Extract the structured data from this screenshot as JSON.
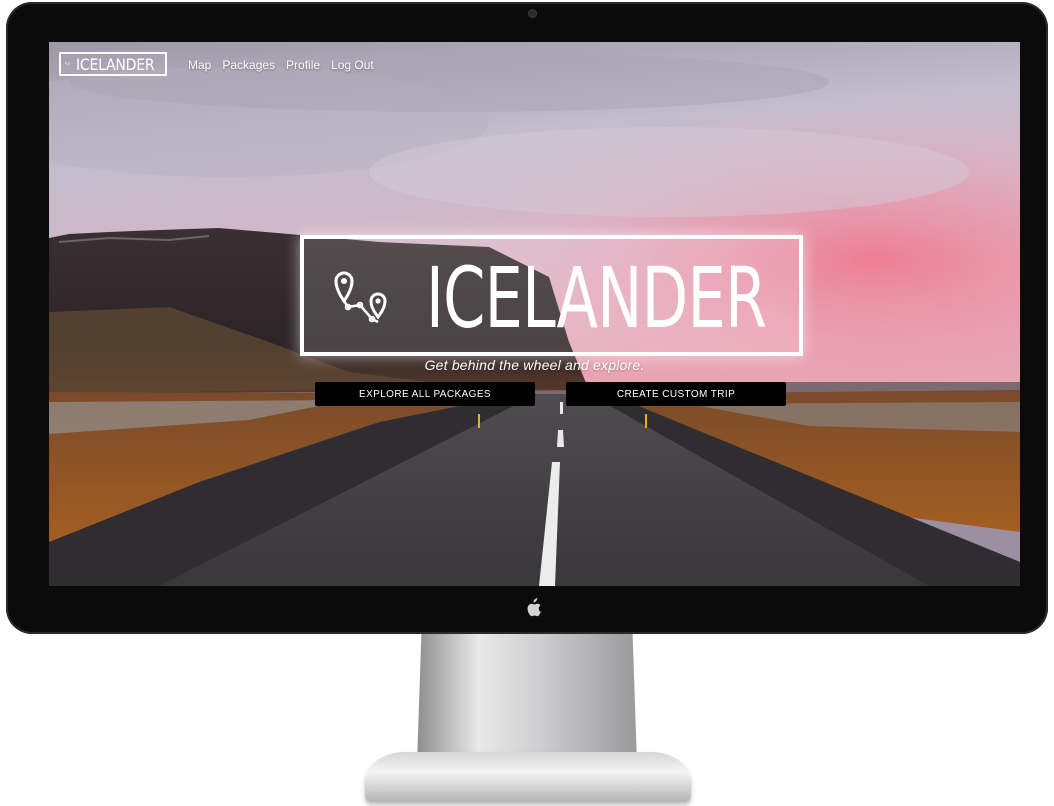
{
  "monitor": {
    "brand_icon": "apple-logo-icon"
  },
  "navbar": {
    "logo_text": "ICELANDER",
    "logo_icon": "route-pins-icon",
    "links": [
      {
        "label": "Map"
      },
      {
        "label": "Packages"
      },
      {
        "label": "Profile"
      },
      {
        "label": "Log Out"
      }
    ]
  },
  "hero": {
    "title": "ICELANDER",
    "icon": "route-pins-icon",
    "tagline": "Get behind the wheel and explore.",
    "buttons": {
      "explore": "EXPLORE ALL PACKAGES",
      "custom": "CREATE CUSTOM TRIP"
    }
  },
  "theme": {
    "accent": "#ffffff",
    "button_bg": "#000000",
    "sky_top": "#a7a3b4",
    "sky_pink": "#e98aa6"
  }
}
